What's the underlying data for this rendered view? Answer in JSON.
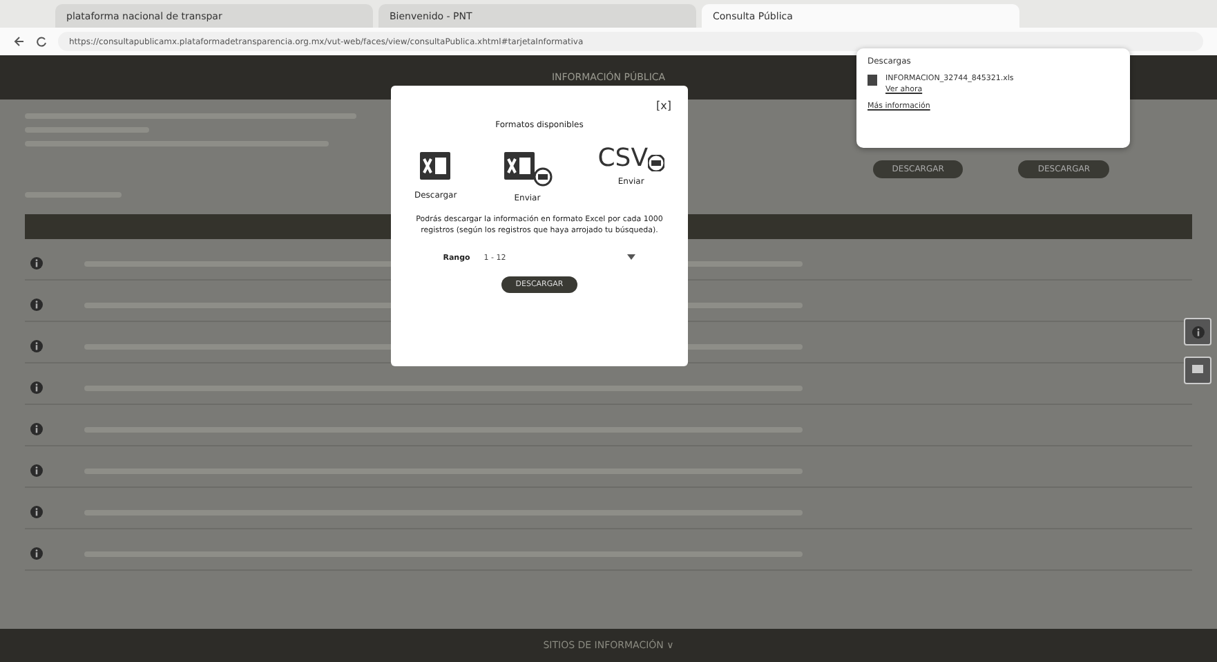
{
  "browser": {
    "tabs": [
      {
        "label": "plataforma nacional de transpar",
        "selected": false
      },
      {
        "label": "Bienvenido - PNT",
        "selected": false
      },
      {
        "label": "Consulta Pública",
        "selected": true
      }
    ],
    "url": "https://consultapublicamx.plataformadetransparencia.org.mx/vut-web/faces/view/consultaPublica.xhtml#tarjetaInformativa"
  },
  "header": {
    "title": "INFORMACIÓN PÚBLICA"
  },
  "actions": [
    "DESCARGAR",
    "DESCARGAR"
  ],
  "downloads": {
    "title": "Descargas",
    "file": "INFORMACION_32744_845321.xls",
    "link": "Ver ahora",
    "more": "Más información"
  },
  "modal": {
    "close": "[x]",
    "title": "Formatos disponibles",
    "formats": [
      {
        "kind": "excel",
        "label": "Descargar"
      },
      {
        "kind": "excel-send",
        "label": "Enviar"
      },
      {
        "kind": "csv-send",
        "label": "Enviar",
        "mark": "CSV"
      }
    ],
    "note": "Podrás descargar la información en formato Excel por cada 1000 registros (según los registros que haya arrojado tu búsqueda).",
    "range_label": "Rango",
    "range_value": "1 - 12",
    "button": "DESCARGAR"
  },
  "footer": {
    "label": "SITIOS DE INFORMACIÓN ∨"
  }
}
